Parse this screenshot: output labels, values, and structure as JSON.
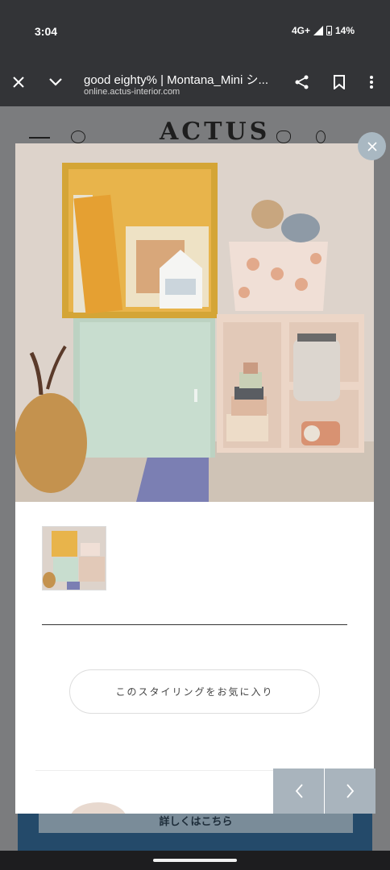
{
  "status_bar": {
    "time": "3:04",
    "network": "4G+",
    "battery": "14%"
  },
  "browser": {
    "title": "good eighty% | Montana_Mini シ...",
    "url": "online.actus-interior.com",
    "close_icon": "close-icon",
    "collapse_icon": "chevron-down-icon",
    "share_icon": "share-icon",
    "bookmark_icon": "bookmark-icon",
    "menu_icon": "more-vert-icon"
  },
  "site": {
    "logo": "ACTUS",
    "detail_button": "詳しくはこちら"
  },
  "modal": {
    "favorite_button": "このスタイリングをお気に入り",
    "photo_alt": "Montana Mini shelves styling",
    "prev_label": "‹",
    "next_label": "›"
  },
  "colors": {
    "accent_nav": "#a9b4bd",
    "brand_blue": "#244a6a"
  }
}
